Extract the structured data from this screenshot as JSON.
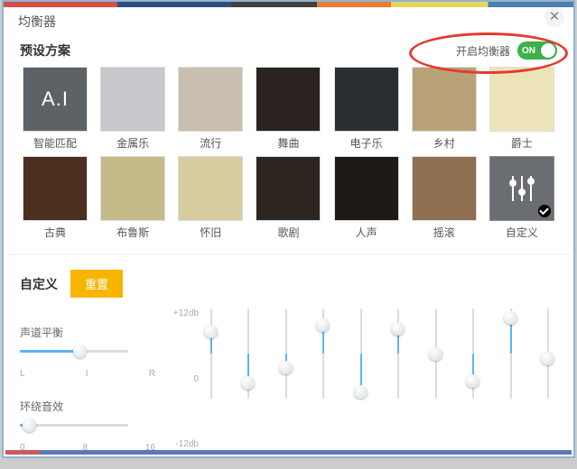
{
  "window": {
    "title": "均衡器"
  },
  "preset_section": {
    "title": "预设方案",
    "enable_label": "开启均衡器",
    "toggle_text": "ON",
    "items": [
      {
        "label": "智能匹配",
        "thumb_text": "A.I"
      },
      {
        "label": "金属乐"
      },
      {
        "label": "流行"
      },
      {
        "label": "舞曲"
      },
      {
        "label": "电子乐"
      },
      {
        "label": "乡村"
      },
      {
        "label": "爵士"
      },
      {
        "label": "古典"
      },
      {
        "label": "布鲁斯"
      },
      {
        "label": "怀旧"
      },
      {
        "label": "歌剧"
      },
      {
        "label": "人声"
      },
      {
        "label": "摇滚"
      },
      {
        "label": "自定义",
        "kind": "custom",
        "selected": true
      }
    ]
  },
  "custom_section": {
    "title": "自定义",
    "reset": "重置",
    "balance": {
      "label": "声道平衡",
      "ticks": [
        "L",
        "I",
        "R"
      ],
      "value_pct": 55
    },
    "surround": {
      "label": "环绕音效",
      "ticks": [
        "0",
        "8",
        "16"
      ],
      "value_pct": 8
    },
    "eq": {
      "db_labels": [
        "+12db",
        "0",
        "-12db"
      ],
      "bands_pct": [
        75,
        18,
        35,
        82,
        8,
        78,
        50,
        20,
        90,
        45
      ]
    }
  }
}
